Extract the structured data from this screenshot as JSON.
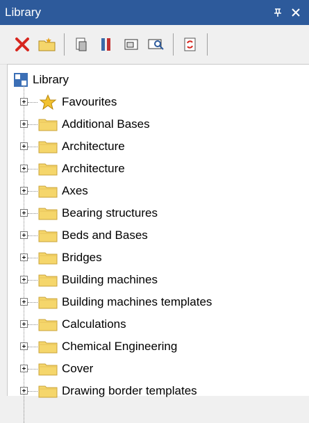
{
  "window": {
    "title": "Library"
  },
  "titlebar": {
    "pin_icon": "pin-icon",
    "close_icon": "close-icon"
  },
  "toolbar": {
    "items": [
      {
        "name": "delete-button",
        "icon": "red-x-icon"
      },
      {
        "name": "new-folder-button",
        "icon": "folder-new-icon"
      },
      {
        "name": "properties-button",
        "icon": "document-properties-icon"
      },
      {
        "name": "tools-button",
        "icon": "tools-icon"
      },
      {
        "name": "insert-button",
        "icon": "insert-window-icon"
      },
      {
        "name": "preview-button",
        "icon": "preview-icon"
      },
      {
        "name": "refresh-button",
        "icon": "refresh-icon"
      }
    ]
  },
  "tree": {
    "root": {
      "label": "Library",
      "icon": "library-icon"
    },
    "items": [
      {
        "label": "Favourites",
        "icon": "star-icon"
      },
      {
        "label": "Additional Bases",
        "icon": "folder-icon"
      },
      {
        "label": "Architecture",
        "icon": "folder-icon"
      },
      {
        "label": "Architecture",
        "icon": "folder-icon"
      },
      {
        "label": "Axes",
        "icon": "folder-icon"
      },
      {
        "label": "Bearing structures",
        "icon": "folder-icon"
      },
      {
        "label": "Beds and Bases",
        "icon": "folder-icon"
      },
      {
        "label": "Bridges",
        "icon": "folder-icon"
      },
      {
        "label": "Building machines",
        "icon": "folder-icon"
      },
      {
        "label": "Building machines templates",
        "icon": "folder-icon"
      },
      {
        "label": "Calculations",
        "icon": "folder-icon"
      },
      {
        "label": "Chemical Engineering",
        "icon": "folder-icon"
      },
      {
        "label": "Cover",
        "icon": "folder-icon"
      },
      {
        "label": "Drawing border templates",
        "icon": "folder-icon"
      }
    ]
  },
  "colors": {
    "titlebar": "#2d5a9b",
    "folder": "#f5d66b"
  }
}
